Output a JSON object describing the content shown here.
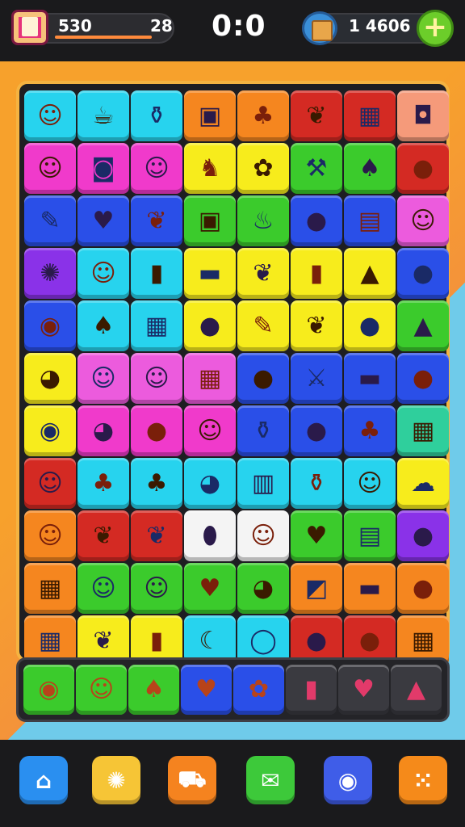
{
  "header": {
    "coins": "530",
    "level": "28",
    "score": "0:0",
    "gold": "1 4606",
    "plus_label": "+"
  },
  "colors": {
    "cyan": "#27d3ee",
    "orange": "#f5861f",
    "red": "#d42a23",
    "salmon": "#f59a7a",
    "magenta": "#f03acb",
    "yellow": "#f7ec1c",
    "green": "#3bcb2c",
    "blue": "#2a4fe8",
    "pink": "#ec5bdd",
    "purple": "#8a32e8",
    "teal": "#2fcf9c",
    "white": "#f4f4f4"
  },
  "tiles": [
    {
      "c": "cyan",
      "icon": "face",
      "g": "☺"
    },
    {
      "c": "cyan",
      "icon": "cup",
      "g": "☕"
    },
    {
      "c": "cyan",
      "icon": "bottle",
      "g": "⚱"
    },
    {
      "c": "orange",
      "icon": "box",
      "g": "▣"
    },
    {
      "c": "orange",
      "icon": "pepper",
      "g": "♣"
    },
    {
      "c": "red",
      "icon": "leaf",
      "g": "❦"
    },
    {
      "c": "red",
      "icon": "crate",
      "g": "▦"
    },
    {
      "c": "salmon",
      "icon": "drum",
      "g": "◘"
    },
    {
      "c": "magenta",
      "icon": "face-hat",
      "g": "☺"
    },
    {
      "c": "magenta",
      "icon": "jar",
      "g": "◙"
    },
    {
      "c": "magenta",
      "icon": "moon-face",
      "g": "☺"
    },
    {
      "c": "yellow",
      "icon": "horse",
      "g": "♞"
    },
    {
      "c": "yellow",
      "icon": "shell",
      "g": "✿"
    },
    {
      "c": "green",
      "icon": "hammer",
      "g": "⚒"
    },
    {
      "c": "green",
      "icon": "monkey",
      "g": "♠"
    },
    {
      "c": "red",
      "icon": "tomato",
      "g": "●"
    },
    {
      "c": "blue",
      "icon": "syringe",
      "g": "✎"
    },
    {
      "c": "blue",
      "icon": "heart",
      "g": "♥"
    },
    {
      "c": "blue",
      "icon": "leaf",
      "g": "❦"
    },
    {
      "c": "green",
      "icon": "frame",
      "g": "▣"
    },
    {
      "c": "green",
      "icon": "kettle",
      "g": "♨"
    },
    {
      "c": "blue",
      "icon": "apple",
      "g": "●"
    },
    {
      "c": "blue",
      "icon": "chest",
      "g": "▤"
    },
    {
      "c": "pink",
      "icon": "orange",
      "g": "☺"
    },
    {
      "c": "purple",
      "icon": "candy",
      "g": "✺"
    },
    {
      "c": "cyan",
      "icon": "cat",
      "g": "☺"
    },
    {
      "c": "cyan",
      "icon": "jar",
      "g": "▮"
    },
    {
      "c": "yellow",
      "icon": "tube",
      "g": "▬"
    },
    {
      "c": "yellow",
      "icon": "leaf",
      "g": "❦"
    },
    {
      "c": "yellow",
      "icon": "bottle",
      "g": "▮"
    },
    {
      "c": "yellow",
      "icon": "hat",
      "g": "▲"
    },
    {
      "c": "blue",
      "icon": "apple",
      "g": "●"
    },
    {
      "c": "blue",
      "icon": "donut",
      "g": "◉"
    },
    {
      "c": "cyan",
      "icon": "pepper",
      "g": "♠"
    },
    {
      "c": "cyan",
      "icon": "box",
      "g": "▦"
    },
    {
      "c": "yellow",
      "icon": "tomato",
      "g": "●"
    },
    {
      "c": "yellow",
      "icon": "pen",
      "g": "✎"
    },
    {
      "c": "yellow",
      "icon": "leaf",
      "g": "❦"
    },
    {
      "c": "yellow",
      "icon": "grape",
      "g": "●"
    },
    {
      "c": "green",
      "icon": "cheese",
      "g": "▲"
    },
    {
      "c": "yellow",
      "icon": "lollipop",
      "g": "◕"
    },
    {
      "c": "pink",
      "icon": "face",
      "g": "☺"
    },
    {
      "c": "pink",
      "icon": "face",
      "g": "☺"
    },
    {
      "c": "pink",
      "icon": "chocolate",
      "g": "▦"
    },
    {
      "c": "blue",
      "icon": "nut",
      "g": "●"
    },
    {
      "c": "blue",
      "icon": "sword",
      "g": "⚔"
    },
    {
      "c": "blue",
      "icon": "bread",
      "g": "▬"
    },
    {
      "c": "blue",
      "icon": "apple",
      "g": "●"
    },
    {
      "c": "yellow",
      "icon": "clock",
      "g": "◉"
    },
    {
      "c": "magenta",
      "icon": "shell",
      "g": "◕"
    },
    {
      "c": "magenta",
      "icon": "plum",
      "g": "●"
    },
    {
      "c": "magenta",
      "icon": "face",
      "g": "☺"
    },
    {
      "c": "blue",
      "icon": "vase",
      "g": "⚱"
    },
    {
      "c": "blue",
      "icon": "apple",
      "g": "●"
    },
    {
      "c": "blue",
      "icon": "ice",
      "g": "♣"
    },
    {
      "c": "teal",
      "icon": "crate",
      "g": "▦"
    },
    {
      "c": "red",
      "icon": "girl",
      "g": "☺"
    },
    {
      "c": "cyan",
      "icon": "cherry",
      "g": "♣"
    },
    {
      "c": "cyan",
      "icon": "cherry",
      "g": "♣"
    },
    {
      "c": "cyan",
      "icon": "lollipop",
      "g": "◕"
    },
    {
      "c": "cyan",
      "icon": "lantern",
      "g": "▥"
    },
    {
      "c": "cyan",
      "icon": "potion",
      "g": "⚱"
    },
    {
      "c": "cyan",
      "icon": "face",
      "g": "☺"
    },
    {
      "c": "yellow",
      "icon": "pig",
      "g": "☁"
    },
    {
      "c": "orange",
      "icon": "face",
      "g": "☺"
    },
    {
      "c": "red",
      "icon": "leaf",
      "g": "❦"
    },
    {
      "c": "red",
      "icon": "leaf",
      "g": "❦"
    },
    {
      "c": "white",
      "icon": "egg",
      "g": "⬮"
    },
    {
      "c": "white",
      "icon": "alien",
      "g": "☺"
    },
    {
      "c": "green",
      "icon": "heart",
      "g": "♥"
    },
    {
      "c": "green",
      "icon": "brush",
      "g": "▤"
    },
    {
      "c": "purple",
      "icon": "apple",
      "g": "●"
    },
    {
      "c": "orange",
      "icon": "chest",
      "g": "▦"
    },
    {
      "c": "green",
      "icon": "cat",
      "g": "☺"
    },
    {
      "c": "green",
      "icon": "cat",
      "g": "☺"
    },
    {
      "c": "green",
      "icon": "radish",
      "g": "♥"
    },
    {
      "c": "green",
      "icon": "mirror",
      "g": "◕"
    },
    {
      "c": "orange",
      "icon": "book",
      "g": "◩"
    },
    {
      "c": "orange",
      "icon": "ice",
      "g": "▬"
    },
    {
      "c": "orange",
      "icon": "lime",
      "g": "●"
    },
    {
      "c": "orange",
      "icon": "bag",
      "g": "▦"
    },
    {
      "c": "yellow",
      "icon": "leaf",
      "g": "❦"
    },
    {
      "c": "yellow",
      "icon": "can",
      "g": "▮"
    },
    {
      "c": "cyan",
      "icon": "banana",
      "g": "☾"
    },
    {
      "c": "cyan",
      "icon": "mirror",
      "g": "◯"
    },
    {
      "c": "red",
      "icon": "carrot",
      "g": "●"
    },
    {
      "c": "red",
      "icon": "apple",
      "g": "●"
    },
    {
      "c": "orange",
      "icon": "chest",
      "g": "▦"
    }
  ],
  "tray": [
    {
      "c": "green",
      "icon": "basketball",
      "g": "◉"
    },
    {
      "c": "green",
      "icon": "cat",
      "g": "☺"
    },
    {
      "c": "green",
      "icon": "pepper",
      "g": "♠"
    },
    {
      "c": "blue",
      "icon": "heart",
      "g": "♥"
    },
    {
      "c": "blue",
      "icon": "flower",
      "g": "✿"
    },
    {
      "c": "dark",
      "icon": "cup",
      "g": "▮"
    },
    {
      "c": "dark",
      "icon": "heart",
      "g": "♥"
    },
    {
      "c": "dark",
      "icon": "cake",
      "g": "▲"
    }
  ],
  "nav": [
    {
      "name": "shop-button",
      "icon": "house-icon",
      "g": "⌂",
      "color": "#2a8ff0"
    },
    {
      "name": "sun-button",
      "icon": "sun-icon",
      "g": "✺",
      "color": "#f6c536"
    },
    {
      "name": "bakery-button",
      "icon": "bag-icon",
      "g": "⛟",
      "color": "#f5831f"
    },
    {
      "name": "chat-button",
      "icon": "chat-icon",
      "g": "✉",
      "color": "#3dc93a"
    },
    {
      "name": "photo-button",
      "icon": "camera-icon",
      "g": "◉",
      "color": "#3f5de8"
    },
    {
      "name": "dice-button",
      "icon": "dice-icon",
      "g": "⁙",
      "color": "#f58a1a"
    }
  ]
}
